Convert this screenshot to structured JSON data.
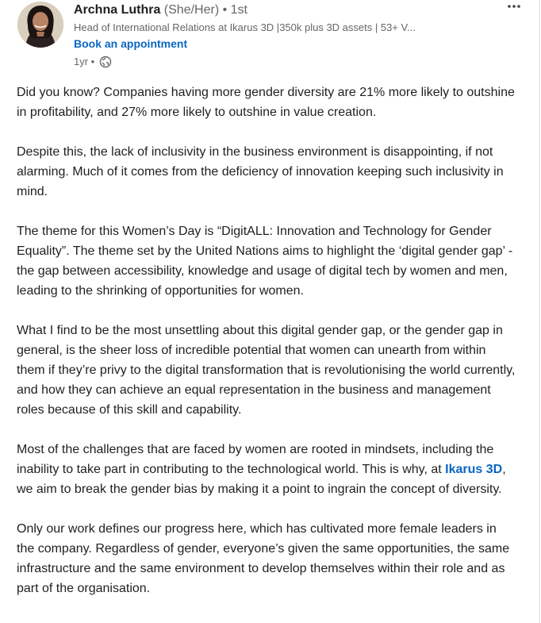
{
  "post": {
    "author": {
      "name": "Archna Luthra",
      "pronouns": "(She/Her)",
      "connection": "• 1st",
      "headline": "Head of International Relations at Ikarus 3D |350k plus 3D assets | 53+ V...",
      "cta": "Book an appointment"
    },
    "time": "1yr •",
    "visibility_icon": "globe-icon",
    "more_icon": "more-options-icon",
    "paragraphs": {
      "p1": "Did you know? Companies having more gender diversity are 21% more likely to outshine in profitability, and 27% more likely to outshine in value creation.",
      "p2": "Despite this, the lack of inclusivity in the business environment is disappointing, if not alarming. Much of it comes from the deficiency of innovation keeping such inclusivity in mind.",
      "p3": "The theme for this Women’s Day is “DigitALL: Innovation and Technology for Gender Equality”. The theme set by the United Nations aims to highlight the ‘digital gender gap’ - the gap between accessibility, knowledge and usage of digital tech by women and men, leading to the shrinking of opportunities for women.",
      "p4": "What I find to be the most unsettling about this digital gender gap, or the gender gap in general, is the sheer loss of incredible potential that women can unearth from within them if they’re privy to the digital transformation that is revolutionising the world currently, and how they can achieve an equal representation in the business and management roles because of this skill and capability.",
      "p5_before": "Most of the challenges that are faced by women are rooted in mindsets, including the inability to take part in contributing to the technological world. This is why, at ",
      "p5_mention": "Ikarus 3D",
      "p5_after": ", we aim to break the gender bias by making it a point to ingrain the concept of diversity.",
      "p6": "Only our work defines our progress here, which has cultivated more female leaders in the company. Regardless of gender, everyone’s given the same opportunities, the same infrastructure and the same environment to develop themselves within their role and as part of the organisation."
    }
  },
  "colors": {
    "link": "#0a66c2",
    "text": "#1f1f1f",
    "muted": "#666666"
  }
}
